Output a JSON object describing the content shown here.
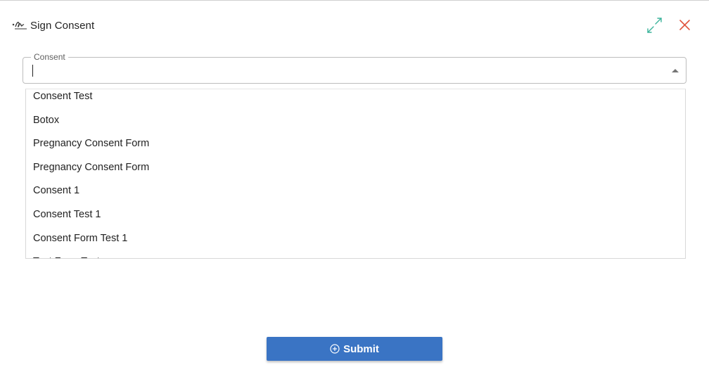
{
  "dialog": {
    "title": "Sign Consent",
    "title_icon": "signature-icon",
    "expand_icon": "expand-icon",
    "close_icon": "close-icon",
    "accent_color": "#3a74c4",
    "expand_color": "#3bb39b",
    "close_color": "#e0543d"
  },
  "consent_field": {
    "label": "Consent",
    "value": ""
  },
  "options": [
    "Consent Test",
    "Botox",
    "Pregnancy Consent Form",
    "Pregnancy Consent Form",
    "Consent 1",
    "Consent Test 1",
    "Consent Form Test 1",
    "Test Form Test"
  ],
  "submit": {
    "label": "Submit",
    "icon": "plus-circle-icon"
  }
}
